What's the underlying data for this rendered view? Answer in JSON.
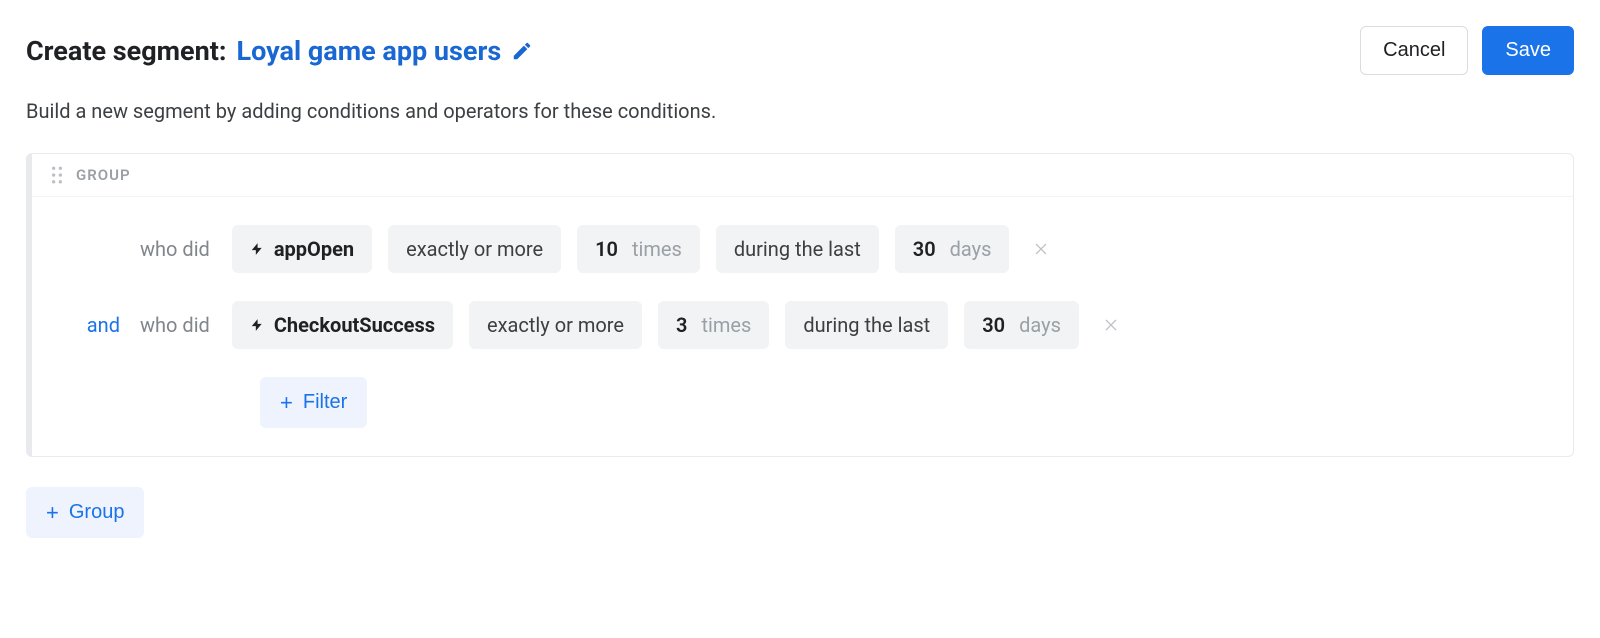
{
  "header": {
    "title_prefix": "Create segment:",
    "segment_name": "Loyal game app users",
    "cancel_label": "Cancel",
    "save_label": "Save"
  },
  "subtitle": "Build a new segment by adding conditions and operators for these conditions.",
  "group": {
    "label": "GROUP",
    "conditions": [
      {
        "connector": "",
        "who_did": "who did",
        "event": "appOpen",
        "comparator": "exactly or more",
        "count_value": "10",
        "count_unit": "times",
        "range_label": "during the last",
        "range_value": "30",
        "range_unit": "days"
      },
      {
        "connector": "and",
        "who_did": "who did",
        "event": "CheckoutSuccess",
        "comparator": "exactly or more",
        "count_value": "3",
        "count_unit": "times",
        "range_label": "during the last",
        "range_value": "30",
        "range_unit": "days"
      }
    ],
    "add_filter_label": "Filter"
  },
  "add_group_label": "Group"
}
